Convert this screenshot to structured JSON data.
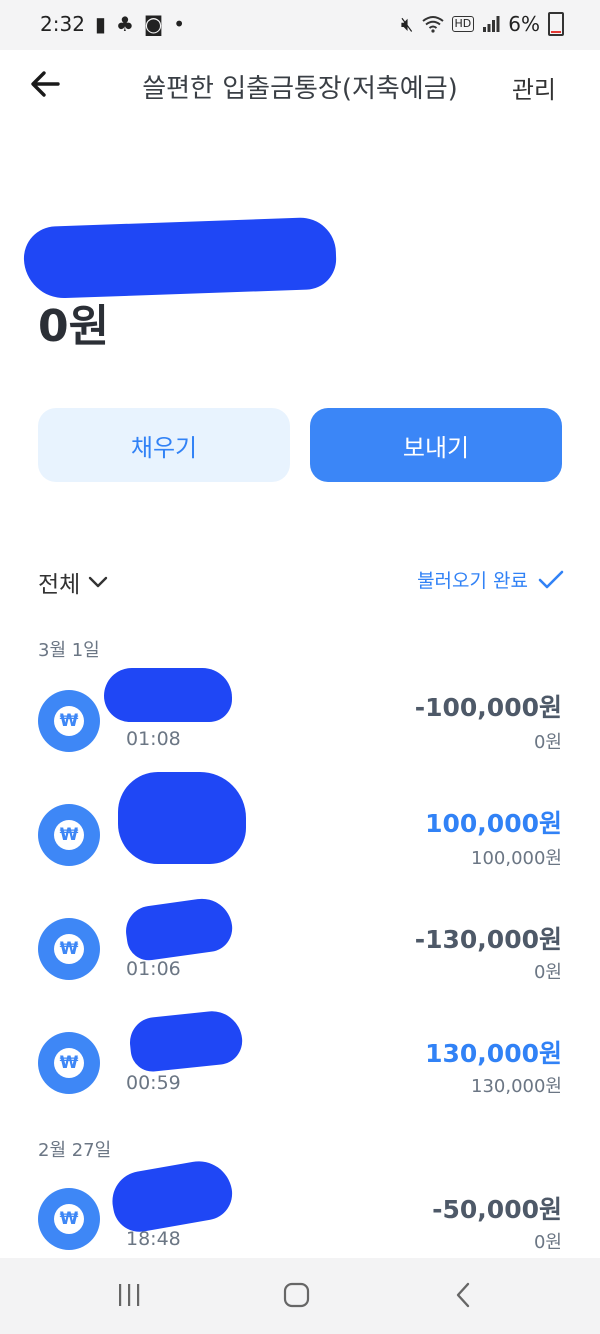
{
  "status": {
    "time": "2:32",
    "battery": "6%",
    "hd": "HD"
  },
  "header": {
    "back_icon": "back-arrow-icon",
    "title": "쓸편한 입출금통장(저축예금)",
    "manage": "관리"
  },
  "account": {
    "balance": "0원"
  },
  "actions": {
    "fill": "채우기",
    "send": "보내기"
  },
  "filter": {
    "label": "전체",
    "loaded": "불러오기 완료"
  },
  "groups": [
    {
      "date": "3월 1일",
      "items": [
        {
          "time": "01:08",
          "amount": "-100,000원",
          "balance": "0원"
        },
        {
          "time": "",
          "amount": "100,000원",
          "balance": "100,000원"
        },
        {
          "time": "01:06",
          "amount": "-130,000원",
          "balance": "0원"
        },
        {
          "time": "00:59",
          "amount": "130,000원",
          "balance": "130,000원"
        }
      ]
    },
    {
      "date": "2월 27일",
      "items": [
        {
          "time": "18:48",
          "amount": "-50,000원",
          "balance": "0원"
        }
      ]
    }
  ],
  "icons": {
    "won": "₩"
  },
  "colors": {
    "accent": "#3182f6",
    "redaction": "#1f47f5"
  }
}
